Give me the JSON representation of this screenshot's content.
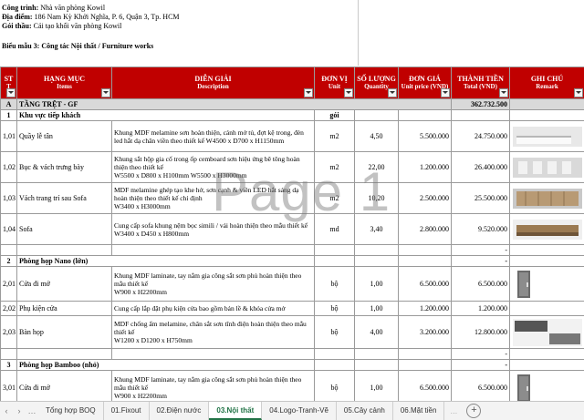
{
  "project": {
    "label_ct": "Công trình:",
    "ct": " Nhà văn phòng Kowil",
    "label_dd": "Địa điểm:",
    "dd": " 186 Nam Kỳ Khởi Nghĩa, P. 6, Quận 3, Tp. HCM",
    "label_gt": "Gói thầu:",
    "gt": " Cải tạo khối văn phòng Kowil",
    "form_title": "Biểu mẫu 3: Công tác Nội thất / Furniture works"
  },
  "headers": {
    "stt": "ST",
    "stt2": "T",
    "item": "HẠNG MỤC",
    "item_en": "Items",
    "desc": "DIỄN GIẢI",
    "desc_en": "Description",
    "unit": "ĐƠN VỊ",
    "unit_en": "Unit",
    "qty": "SỐ LƯỢNG",
    "qty_en": "Quantity",
    "price": "ĐƠN GIÁ",
    "price_en": "Unit price (VND)",
    "total": "THÀNH TIỀN",
    "total_en": "Total (VND)",
    "note": "GHI CHÚ",
    "note_en": "Remark"
  },
  "section_a": {
    "stt": "A",
    "name": "TẦNG TRỆT - GF",
    "total": "362.732.500"
  },
  "groups": {
    "g1": {
      "stt": "1",
      "name": "Khu vực tiếp khách",
      "unit": "gói"
    },
    "g2": {
      "stt": "2",
      "name": "Phòng họp Nano (lớn)",
      "total": "-"
    },
    "g3": {
      "stt": "3",
      "name": "Phòng họp Bamboo (nhỏ)",
      "total": "-"
    }
  },
  "rows": [
    {
      "stt": "1,01",
      "item": "Quầy lễ tân",
      "desc": "Khung MDF melamine sơn hoàn thiện, cánh mở tủ, đợt kệ trong, đèn led hắt dạ chân viền theo thiết kế  W4500 x D700 x H1150mm",
      "unit": "m2",
      "qty": "4,50",
      "price": "5.500.000",
      "total": "24.750.000"
    },
    {
      "stt": "1,02",
      "item": "Bục & vách trưng bày",
      "desc": "Khung sắt hộp gia cố trong ốp cemboard sơn hiệu ứng bê tông hoàn thiện theo thiết kế\nW5500 x D800 x H100mm W5500 x H3000mm",
      "unit": "m2",
      "qty": "22,00",
      "price": "1.200.000",
      "total": "26.400.000"
    },
    {
      "stt": "1,03",
      "item": "Vách trang trí sau Sofa",
      "desc": "MDF melamine ghép tạo khe hở, sơn cạnh & viền LED hắt sáng dạ hoàn thiện theo thiết kế chỉ định\nW3400 x H3000mm",
      "unit": "m2",
      "qty": "10,20",
      "price": "2.500.000",
      "total": "25.500.000"
    },
    {
      "stt": "1,04",
      "item": "Sofa",
      "desc": "Cung cấp sofa khung nệm bọc simili / vải hoàn thiện theo mẫu thiết kế\nW3400 x D450 x H800mm",
      "unit": "md",
      "qty": "3,40",
      "price": "2.800.000",
      "total": "9.520.000"
    },
    {
      "stt": "2,01",
      "item": "Cửa đi mở",
      "desc": "Khung MDF laminate, tay nắm gia công sắt sơn phủ hoàn thiện theo mẫu thiết kế\nW900 x H2200mm",
      "unit": "bộ",
      "qty": "1,00",
      "price": "6.500.000",
      "total": "6.500.000"
    },
    {
      "stt": "2,02",
      "item": "Phụ kiện cửa",
      "desc": "Cung cấp lắp đặt phụ kiện cửa bao gồm bản lề & khóa cửa mở",
      "unit": "bộ",
      "qty": "1,00",
      "price": "1.200.000",
      "total": "1.200.000"
    },
    {
      "stt": "2,03",
      "item": "Bàn họp",
      "desc": "MDF chống ẩm melamine, chân  sắt sơn tĩnh điện hoàn thiện theo mẫu thiết kế\nW1200 x D1200 x H750mm",
      "unit": "bộ",
      "qty": "4,00",
      "price": "3.200.000",
      "total": "12.800.000"
    },
    {
      "stt": "3,01",
      "item": "Cửa đi mở",
      "desc": "Khung MDF laminate, tay nắm gia công sắt sơn phủ hoàn thiện theo mẫu thiết kế\nW900 x H2200mm",
      "unit": "bộ",
      "qty": "1,00",
      "price": "6.500.000",
      "total": "6.500.000"
    }
  ],
  "dash": "-",
  "watermark": "Page 1",
  "tabs": [
    "Tổng hợp BOQ",
    "01.Fixout",
    "02.Điện nước",
    "03.Nội thất",
    "04.Logo-Tranh-Vẽ",
    "05.Cây cảnh",
    "06.Mặt tiền"
  ],
  "active_tab": "03.Nội thất",
  "colors": {
    "header": "#c00000",
    "section": "#d9d9d9",
    "active_tab": "#217346"
  }
}
